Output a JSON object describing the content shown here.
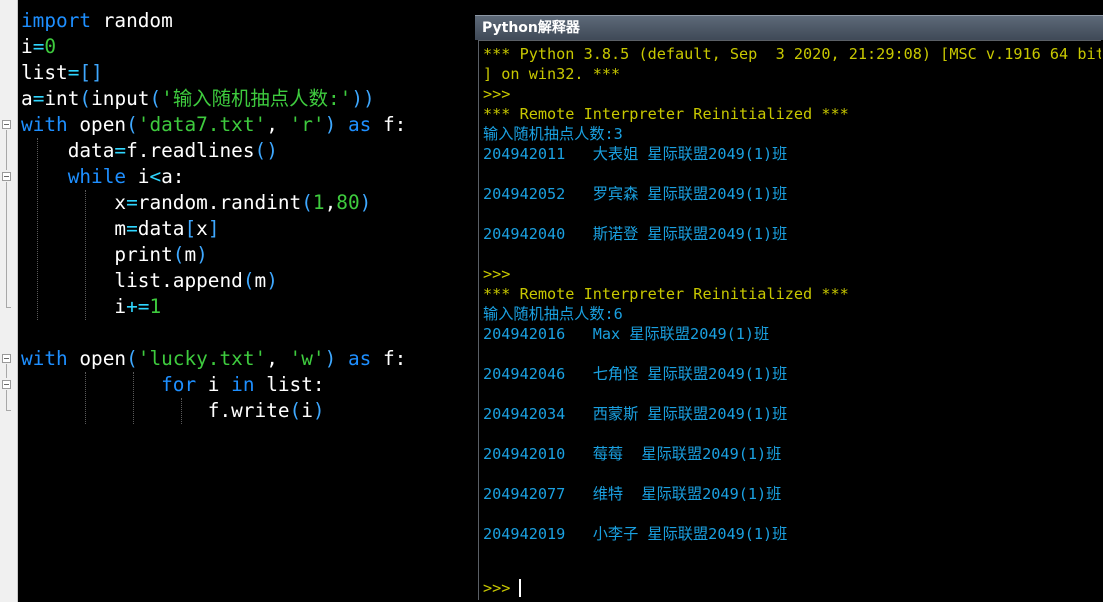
{
  "editor": {
    "lines": [
      {
        "parts": [
          {
            "t": "import",
            "c": "kw"
          },
          {
            "t": " random",
            "c": "tx"
          }
        ]
      },
      {
        "parts": [
          {
            "t": "i",
            "c": "tx"
          },
          {
            "t": "=",
            "c": "op"
          },
          {
            "t": "0",
            "c": "nm"
          }
        ]
      },
      {
        "parts": [
          {
            "t": "list",
            "c": "tx"
          },
          {
            "t": "=",
            "c": "op"
          },
          {
            "t": "[]",
            "c": "pn"
          }
        ]
      },
      {
        "parts": [
          {
            "t": "a",
            "c": "tx"
          },
          {
            "t": "=",
            "c": "op"
          },
          {
            "t": "int",
            "c": "tx"
          },
          {
            "t": "(",
            "c": "pn"
          },
          {
            "t": "input",
            "c": "tx"
          },
          {
            "t": "(",
            "c": "pn"
          },
          {
            "t": "'输入随机抽点人数:'",
            "c": "st"
          },
          {
            "t": "))",
            "c": "pn"
          }
        ]
      },
      {
        "parts": [
          {
            "t": "with",
            "c": "kw"
          },
          {
            "t": " open",
            "c": "tx"
          },
          {
            "t": "(",
            "c": "pn"
          },
          {
            "t": "'data7.txt'",
            "c": "st"
          },
          {
            "t": ", ",
            "c": "tx"
          },
          {
            "t": "'r'",
            "c": "st"
          },
          {
            "t": ")",
            "c": "pn"
          },
          {
            "t": " as",
            "c": "kw"
          },
          {
            "t": " f:",
            "c": "tx"
          }
        ]
      },
      {
        "parts": [
          {
            "t": "    data",
            "c": "tx"
          },
          {
            "t": "=",
            "c": "op"
          },
          {
            "t": "f.readlines",
            "c": "tx"
          },
          {
            "t": "()",
            "c": "pn"
          }
        ]
      },
      {
        "parts": [
          {
            "t": "    while",
            "c": "kw"
          },
          {
            "t": " i",
            "c": "tx"
          },
          {
            "t": "<",
            "c": "op"
          },
          {
            "t": "a:",
            "c": "tx"
          }
        ]
      },
      {
        "parts": [
          {
            "t": "        x",
            "c": "tx"
          },
          {
            "t": "=",
            "c": "op"
          },
          {
            "t": "random.randint",
            "c": "tx"
          },
          {
            "t": "(",
            "c": "pn"
          },
          {
            "t": "1",
            "c": "nm"
          },
          {
            "t": ",",
            "c": "tx"
          },
          {
            "t": "80",
            "c": "nm"
          },
          {
            "t": ")",
            "c": "pn"
          }
        ]
      },
      {
        "parts": [
          {
            "t": "        m",
            "c": "tx"
          },
          {
            "t": "=",
            "c": "op"
          },
          {
            "t": "data",
            "c": "tx"
          },
          {
            "t": "[",
            "c": "pn"
          },
          {
            "t": "x",
            "c": "tx"
          },
          {
            "t": "]",
            "c": "pn"
          }
        ]
      },
      {
        "parts": [
          {
            "t": "        print",
            "c": "tx"
          },
          {
            "t": "(",
            "c": "pn"
          },
          {
            "t": "m",
            "c": "tx"
          },
          {
            "t": ")",
            "c": "pn"
          }
        ]
      },
      {
        "parts": [
          {
            "t": "        list.append",
            "c": "tx"
          },
          {
            "t": "(",
            "c": "pn"
          },
          {
            "t": "m",
            "c": "tx"
          },
          {
            "t": ")",
            "c": "pn"
          }
        ]
      },
      {
        "parts": [
          {
            "t": "        i",
            "c": "tx"
          },
          {
            "t": "+=",
            "c": "op"
          },
          {
            "t": "1",
            "c": "nm"
          }
        ]
      },
      {
        "parts": []
      },
      {
        "parts": [
          {
            "t": "with",
            "c": "kw"
          },
          {
            "t": " open",
            "c": "tx"
          },
          {
            "t": "(",
            "c": "pn"
          },
          {
            "t": "'lucky.txt'",
            "c": "st"
          },
          {
            "t": ", ",
            "c": "tx"
          },
          {
            "t": "'w'",
            "c": "st"
          },
          {
            "t": ")",
            "c": "pn"
          },
          {
            "t": " as",
            "c": "kw"
          },
          {
            "t": " f:",
            "c": "tx"
          }
        ]
      },
      {
        "parts": [
          {
            "t": "            for",
            "c": "kw"
          },
          {
            "t": " i",
            "c": "tx"
          },
          {
            "t": " in",
            "c": "kw"
          },
          {
            "t": " list:",
            "c": "tx"
          }
        ]
      },
      {
        "parts": [
          {
            "t": "                f.write",
            "c": "tx"
          },
          {
            "t": "(",
            "c": "pn"
          },
          {
            "t": "i",
            "c": "tx"
          },
          {
            "t": ")",
            "c": "pn"
          }
        ]
      }
    ]
  },
  "interpreter": {
    "title": "Python解释器",
    "lines": [
      {
        "text": "*** Python 3.8.5 (default, Sep  3 2020, 21:29:08) [MSC v.1916 64 bit",
        "color": "yellow",
        "row": 0
      },
      {
        "text": "] on win32. ***",
        "color": "yellow",
        "row": 1
      },
      {
        "text": ">>>",
        "color": "yellow",
        "row": 2
      },
      {
        "text": "*** Remote Interpreter Reinitialized ***",
        "color": "yellow",
        "row": 3
      },
      {
        "text": "输入随机抽点人数:3",
        "color": "cyan",
        "row": 4
      },
      {
        "text": "204942011   大表姐 星际联盟2049(1)班",
        "color": "cyan",
        "row": 5
      },
      {
        "text": "204942052   罗宾森 星际联盟2049(1)班",
        "color": "cyan",
        "row": 7
      },
      {
        "text": "204942040   斯诺登 星际联盟2049(1)班",
        "color": "cyan",
        "row": 9
      },
      {
        "text": ">>>",
        "color": "yellow",
        "row": 11
      },
      {
        "text": "*** Remote Interpreter Reinitialized ***",
        "color": "yellow",
        "row": 12
      },
      {
        "text": "输入随机抽点人数:6",
        "color": "cyan",
        "row": 13
      },
      {
        "text": "204942016   Max 星际联盟2049(1)班",
        "color": "cyan",
        "row": 14
      },
      {
        "text": "204942046   七角怪 星际联盟2049(1)班",
        "color": "cyan",
        "row": 16
      },
      {
        "text": "204942034   西蒙斯 星际联盟2049(1)班",
        "color": "cyan",
        "row": 18
      },
      {
        "text": "204942010   莓莓  星际联盟2049(1)班",
        "color": "cyan",
        "row": 20
      },
      {
        "text": "204942077   维特  星际联盟2049(1)班",
        "color": "cyan",
        "row": 22
      },
      {
        "text": "204942019   小李子 星际联盟2049(1)班",
        "color": "cyan",
        "row": 24
      }
    ],
    "prompt": ">>>"
  }
}
